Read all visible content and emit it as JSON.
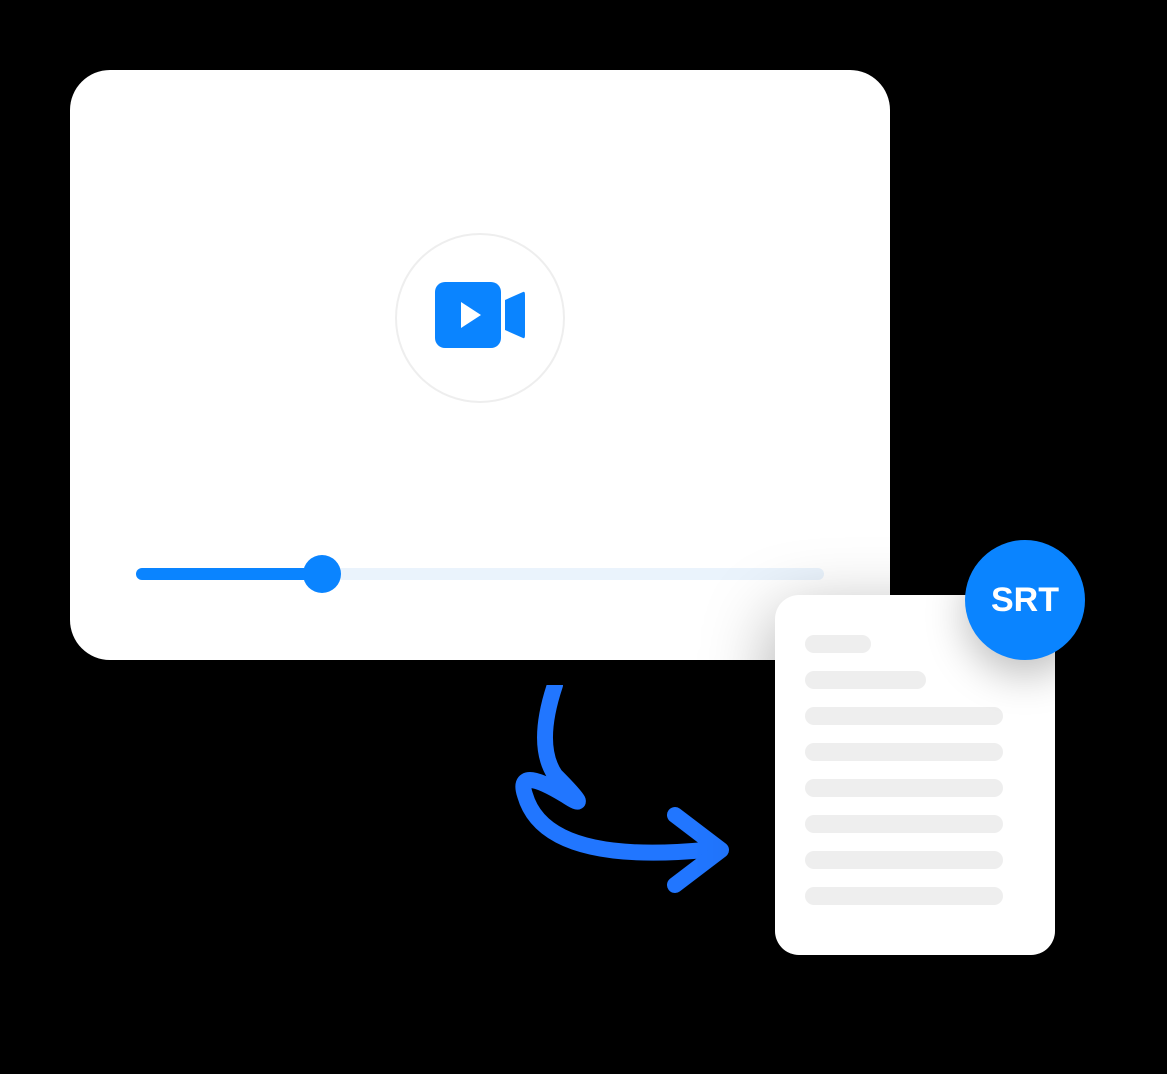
{
  "colors": {
    "accent": "#0a84ff",
    "card_bg": "#ffffff",
    "page_bg": "#000000",
    "muted": "#eeeeee"
  },
  "video": {
    "progress_percent": 27
  },
  "output": {
    "badge_label": "SRT",
    "doc_line_widths": [
      "short",
      "med",
      "long",
      "long",
      "long",
      "long",
      "long",
      "long"
    ]
  }
}
